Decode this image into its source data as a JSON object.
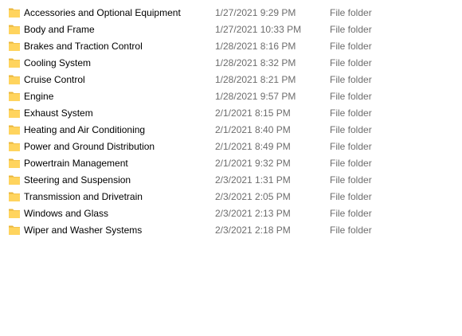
{
  "icons": {
    "folder": "folder-icon",
    "folder_body_color": "#FFD45E",
    "folder_tab_color": "#E8B53B"
  },
  "colors": {
    "name_text": "#000000",
    "meta_text": "#6D6D6D",
    "background": "#FFFFFF"
  },
  "rows": [
    {
      "name": "Accessories and Optional Equipment",
      "date_modified": "1/27/2021 9:29 PM",
      "type": "File folder"
    },
    {
      "name": "Body and Frame",
      "date_modified": "1/27/2021 10:33 PM",
      "type": "File folder"
    },
    {
      "name": "Brakes and Traction Control",
      "date_modified": "1/28/2021 8:16 PM",
      "type": "File folder"
    },
    {
      "name": "Cooling System",
      "date_modified": "1/28/2021 8:32 PM",
      "type": "File folder"
    },
    {
      "name": "Cruise Control",
      "date_modified": "1/28/2021 8:21 PM",
      "type": "File folder"
    },
    {
      "name": "Engine",
      "date_modified": "1/28/2021 9:57 PM",
      "type": "File folder"
    },
    {
      "name": "Exhaust System",
      "date_modified": "2/1/2021 8:15 PM",
      "type": "File folder"
    },
    {
      "name": "Heating and Air Conditioning",
      "date_modified": "2/1/2021 8:40 PM",
      "type": "File folder"
    },
    {
      "name": "Power and Ground Distribution",
      "date_modified": "2/1/2021 8:49 PM",
      "type": "File folder"
    },
    {
      "name": "Powertrain Management",
      "date_modified": "2/1/2021 9:32 PM",
      "type": "File folder"
    },
    {
      "name": "Steering and Suspension",
      "date_modified": "2/3/2021 1:31 PM",
      "type": "File folder"
    },
    {
      "name": "Transmission and Drivetrain",
      "date_modified": "2/3/2021 2:05 PM",
      "type": "File folder"
    },
    {
      "name": "Windows and Glass",
      "date_modified": "2/3/2021 2:13 PM",
      "type": "File folder"
    },
    {
      "name": "Wiper and Washer Systems",
      "date_modified": "2/3/2021 2:18 PM",
      "type": "File folder"
    }
  ]
}
